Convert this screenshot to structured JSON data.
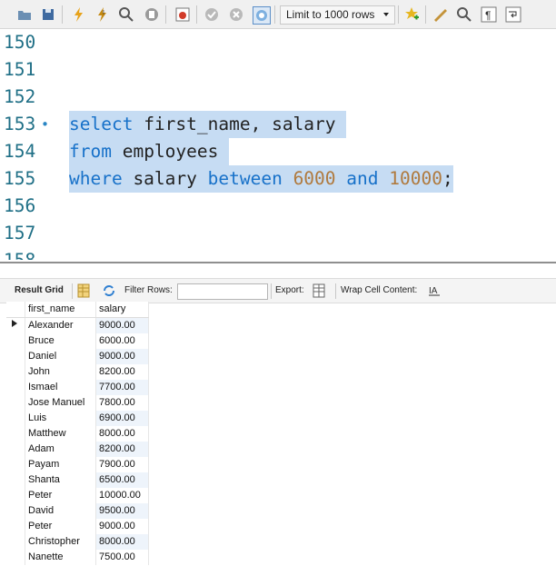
{
  "toolbar": {
    "limit_label": "Limit to 1000 rows",
    "icons": [
      "open-folder-icon",
      "save-icon",
      "execute-icon",
      "execute-current-icon",
      "explain-icon",
      "stop-icon",
      "toggle-error-icon",
      "commit-icon",
      "rollback-icon",
      "autocommit-icon",
      "beautify-icon",
      "find-icon",
      "invisible-chars-icon",
      "wrap-icon"
    ]
  },
  "editor": {
    "lines": [
      {
        "num": "150",
        "code": "",
        "marker": ""
      },
      {
        "num": "151",
        "code": "",
        "marker": ""
      },
      {
        "num": "152",
        "code": "",
        "marker": ""
      },
      {
        "num": "153",
        "marker": "•",
        "tokens": [
          {
            "t": "select",
            "k": "kw"
          },
          {
            "t": " first_name, salary ",
            "k": "plain"
          }
        ]
      },
      {
        "num": "154",
        "marker": "",
        "tokens": [
          {
            "t": "from",
            "k": "kw"
          },
          {
            "t": " employees ",
            "k": "plain"
          }
        ]
      },
      {
        "num": "155",
        "marker": "",
        "tokens": [
          {
            "t": "where",
            "k": "kw"
          },
          {
            "t": " salary ",
            "k": "plain"
          },
          {
            "t": "between",
            "k": "kw"
          },
          {
            "t": " ",
            "k": "plain"
          },
          {
            "t": "6000",
            "k": "num"
          },
          {
            "t": " ",
            "k": "plain"
          },
          {
            "t": "and",
            "k": "kw"
          },
          {
            "t": " ",
            "k": "plain"
          },
          {
            "t": "10000",
            "k": "num"
          },
          {
            "t": ";",
            "k": "plain"
          }
        ]
      },
      {
        "num": "156",
        "code": "",
        "marker": ""
      },
      {
        "num": "157",
        "code": "",
        "marker": ""
      },
      {
        "num": "158",
        "code": "",
        "marker": ""
      }
    ]
  },
  "result_bar": {
    "tab_label": "Result Grid",
    "filter_label": "Filter Rows:",
    "export_label": "Export:",
    "wrap_label": "Wrap Cell Content:"
  },
  "grid": {
    "columns": [
      "first_name",
      "salary"
    ],
    "rows": [
      [
        "Alexander",
        "9000.00"
      ],
      [
        "Bruce",
        "6000.00"
      ],
      [
        "Daniel",
        "9000.00"
      ],
      [
        "John",
        "8200.00"
      ],
      [
        "Ismael",
        "7700.00"
      ],
      [
        "Jose Manuel",
        "7800.00"
      ],
      [
        "Luis",
        "6900.00"
      ],
      [
        "Matthew",
        "8000.00"
      ],
      [
        "Adam",
        "8200.00"
      ],
      [
        "Payam",
        "7900.00"
      ],
      [
        "Shanta",
        "6500.00"
      ],
      [
        "Peter",
        "10000.00"
      ],
      [
        "David",
        "9500.00"
      ],
      [
        "Peter",
        "9000.00"
      ],
      [
        "Christopher",
        "8000.00"
      ],
      [
        "Nanette",
        "7500.00"
      ]
    ]
  }
}
